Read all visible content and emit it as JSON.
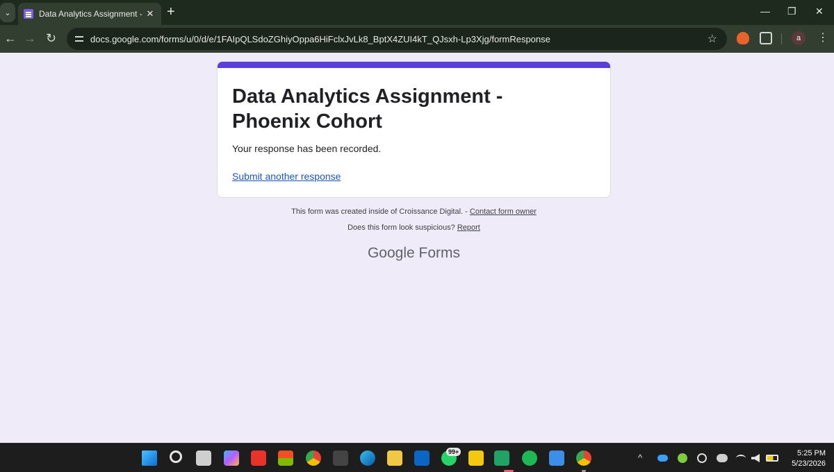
{
  "browser": {
    "tab_title": "Data Analytics Assignment - Ph",
    "tab_close": "✕",
    "new_tab": "+",
    "tab_dropdown": "⌄",
    "url": "docs.google.com/forms/u/0/d/e/1FAIpQLSdoZGhiyOppa6HiFclxJvLk8_BptX4ZUI4kT_QJsxh-Lp3Xjg/formResponse",
    "back": "←",
    "forward": "→",
    "reload": "↻",
    "star": "☆",
    "profile_initial": "a",
    "menu": "⋮",
    "minimize": "—",
    "restore": "❐",
    "close": "✕"
  },
  "form": {
    "title": "Data Analytics Assignment -\n Phoenix Cohort",
    "confirmation": "Your response has been recorded.",
    "submit_another": "Submit another response",
    "accent_color": "#5b3fd8"
  },
  "footer": {
    "created_text": "This form was created inside of Croissance Digital. - ",
    "contact_link": "Contact form owner",
    "suspicious_text": "Does this form look suspicious? ",
    "report_link": "Report",
    "brand_google": "Google",
    "brand_forms": "Forms"
  },
  "taskbar": {
    "whatsapp_badge": "99+",
    "clock_time": "5:25 PM",
    "clock_date": "5/23/2026",
    "tray_chevron": "^"
  }
}
